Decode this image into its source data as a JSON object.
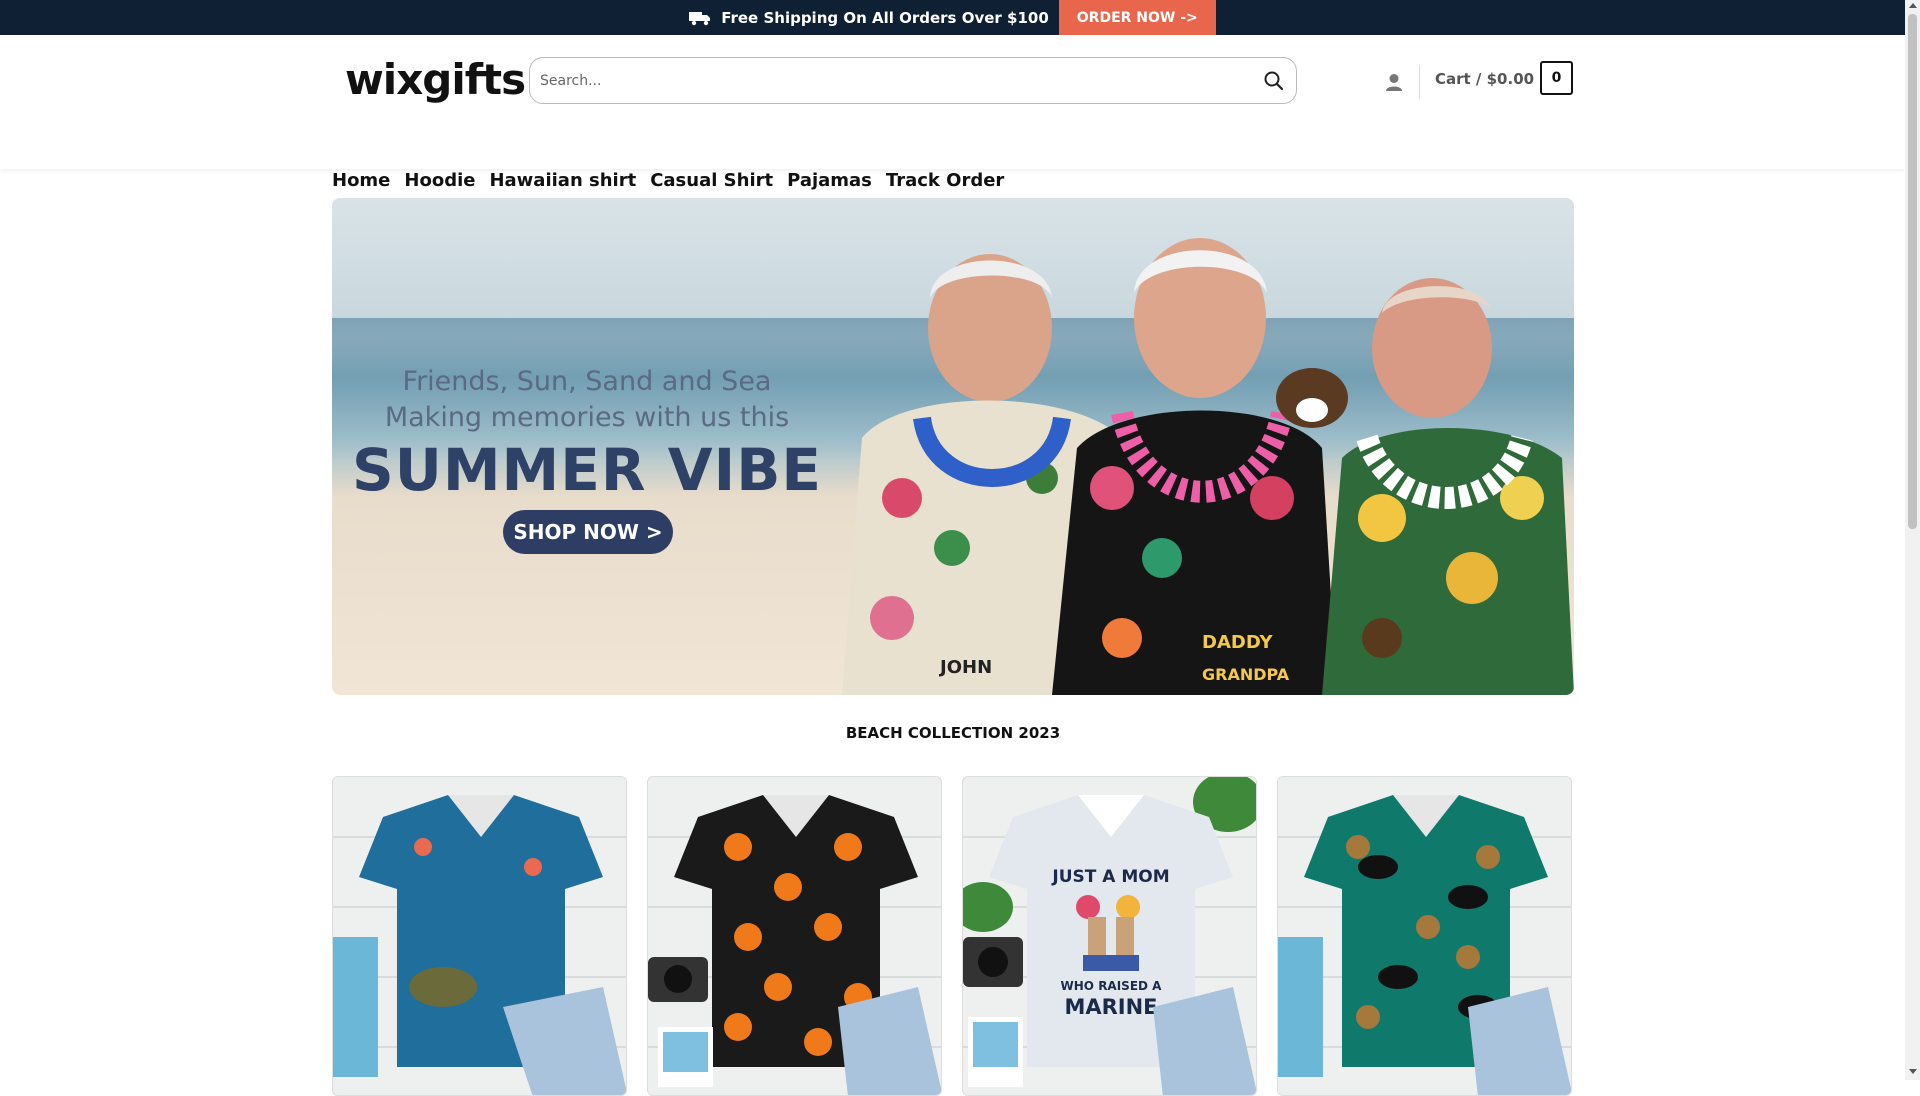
{
  "topbar": {
    "shipping_text": "Free Shipping On All Orders Over $100",
    "order_button": "ORDER NOW ->",
    "background_color": "#0f2035",
    "button_color": "#e8664b",
    "icon": "truck-icon"
  },
  "header": {
    "logo_text": "wixgifts",
    "search": {
      "placeholder": "Search...",
      "icon": "search-icon"
    },
    "account_icon": "user-icon",
    "cart": {
      "label": "Cart / $0.00",
      "count": "0"
    }
  },
  "nav": {
    "items": [
      {
        "label": "Home"
      },
      {
        "label": "Hoodie"
      },
      {
        "label": "Hawaiian shirt"
      },
      {
        "label": "Casual Shirt"
      },
      {
        "label": "Pajamas"
      },
      {
        "label": "Track Order"
      }
    ]
  },
  "banner": {
    "line1": "Friends, Sun, Sand and Sea",
    "line2": "Making memories with us this",
    "headline": "SUMMER VIBE",
    "button": "SHOP NOW >",
    "shirt_text": {
      "john": "JOHN",
      "daddy": "DADDY",
      "grandpa": "GRANDPA"
    }
  },
  "collection": {
    "title": "BEACH COLLECTION 2023",
    "products": [
      {
        "name": "frog-hawaiian-shirt",
        "shirt_color": "#1f6e9c"
      },
      {
        "name": "pumpkin-hawaiian-shirt",
        "shirt_color": "#1a1a1a"
      },
      {
        "name": "just-a-mom-marine-shirt",
        "shirt_color": "#e3e8ee",
        "text_top": "JUST A MOM",
        "text_mid": "WHO RAISED A",
        "text_bot": "MARINE"
      },
      {
        "name": "cat-tropical-hawaiian-shirt",
        "shirt_color": "#0f7a6b"
      }
    ]
  }
}
